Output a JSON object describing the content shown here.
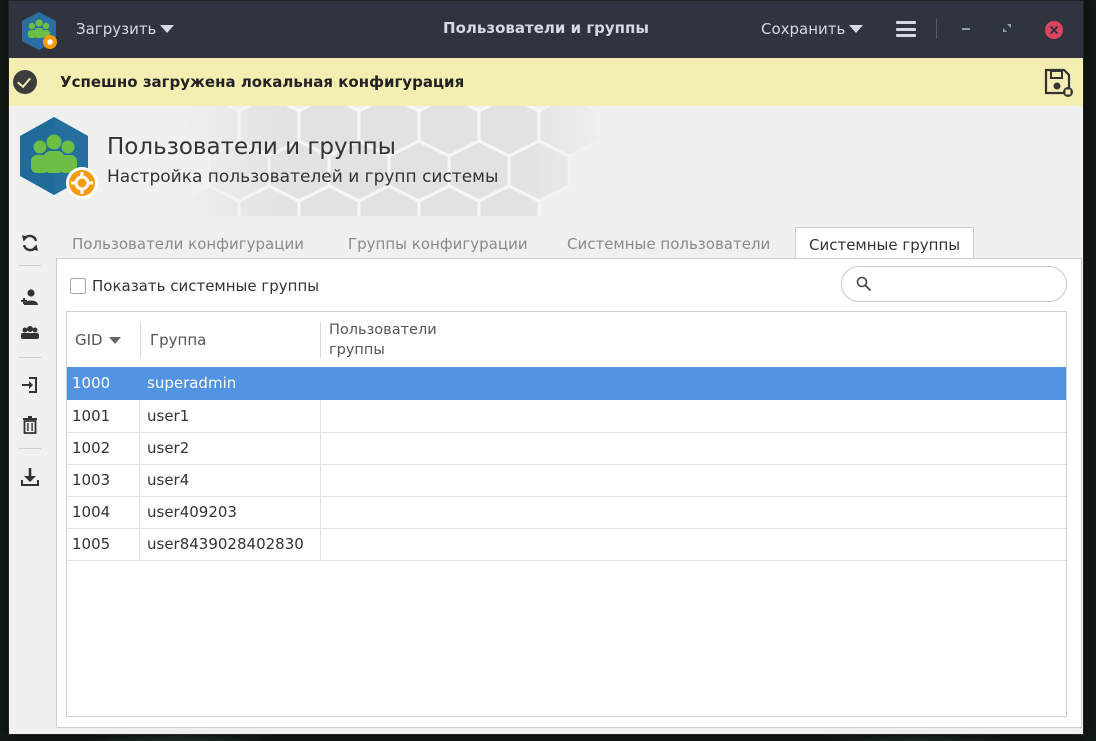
{
  "titlebar": {
    "load_label": "Загрузить",
    "title": "Пользователи и группы",
    "save_label": "Сохранить"
  },
  "notification": {
    "text": "Успешно загружена локальная конфигурация"
  },
  "header": {
    "title": "Пользователи и группы",
    "subtitle": "Настройка пользователей и групп системы"
  },
  "tabs": [
    {
      "label": "Пользователи конфигурации",
      "active": false
    },
    {
      "label": "Группы конфигурации",
      "active": false
    },
    {
      "label": "Системные пользователи",
      "active": false
    },
    {
      "label": "Системные группы",
      "active": true
    }
  ],
  "filters": {
    "show_system_groups_label": "Показать системные группы",
    "show_system_groups_checked": false,
    "search_value": ""
  },
  "table": {
    "columns": {
      "gid": "GID",
      "group": "Группа",
      "users_line1": "Пользователи",
      "users_line2": "группы"
    },
    "rows": [
      {
        "gid": "1000",
        "group": "superadmin",
        "users": "",
        "selected": true
      },
      {
        "gid": "1001",
        "group": "user1",
        "users": "",
        "selected": false
      },
      {
        "gid": "1002",
        "group": "user2",
        "users": "",
        "selected": false
      },
      {
        "gid": "1003",
        "group": "user4",
        "users": "",
        "selected": false
      },
      {
        "gid": "1004",
        "group": "user409203",
        "users": "",
        "selected": false
      },
      {
        "gid": "1005",
        "group": "user8439028402830",
        "users": "",
        "selected": false
      }
    ]
  },
  "colors": {
    "titlebar": "#2f343f",
    "notification": "#f4eeb2",
    "selection": "#5294e2",
    "close": "#e0435e",
    "accent_orange": "#f39c12",
    "logo_green": "#6dbe45"
  }
}
